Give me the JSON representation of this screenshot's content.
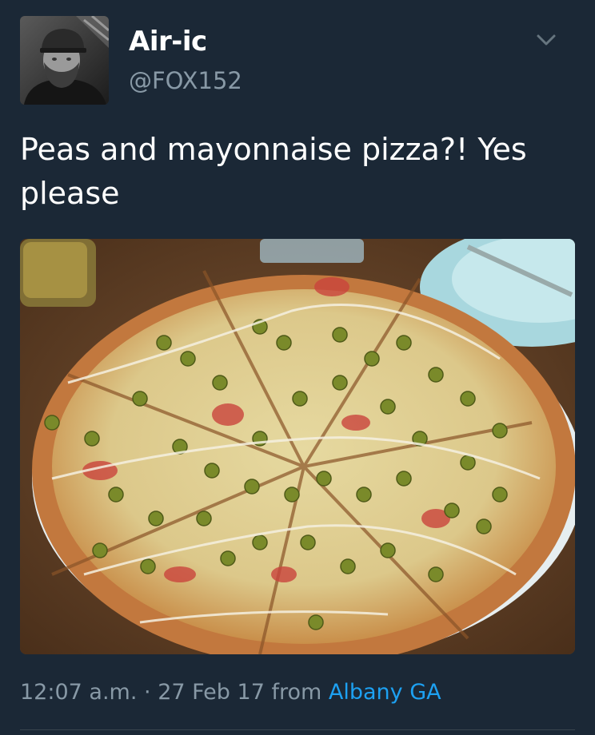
{
  "tweet": {
    "author": {
      "display_name": "Air-ic",
      "handle": "@FOX152",
      "avatar_icon": "user-avatar"
    },
    "menu_icon": "chevron-down-icon",
    "text": "Peas and mayonnaise pizza?! Yes please",
    "media": {
      "icon": "pizza-photo"
    },
    "meta": {
      "time": "12:07 a.m.",
      "separator": "·",
      "date": "27 Feb 17",
      "from_label": "from",
      "location": "Albany GA"
    }
  },
  "colors": {
    "background": "#1b2836",
    "text": "#ffffff",
    "secondary": "#8899a6",
    "link": "#1da1f2"
  }
}
